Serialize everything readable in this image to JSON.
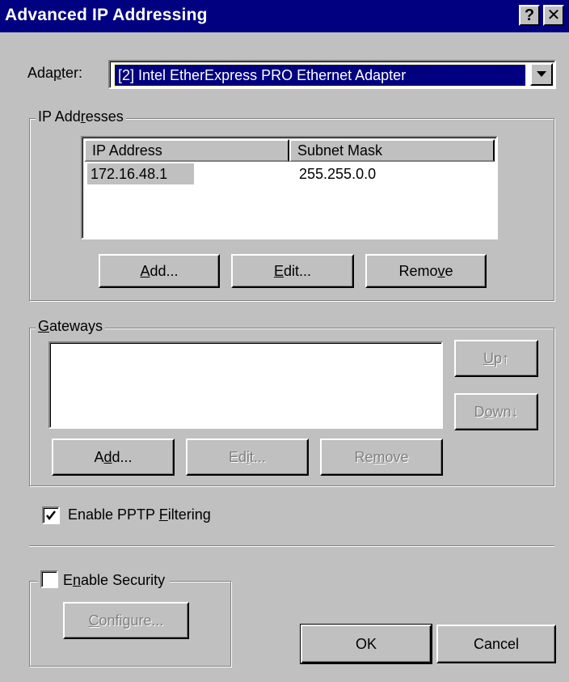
{
  "window": {
    "title": "Advanced IP Addressing",
    "help_icon_char": "?",
    "close_icon_char": "✕"
  },
  "adapter": {
    "label_pre": "Ada",
    "label_ul": "p",
    "label_post": "ter:",
    "selected": "[2] Intel EtherExpress PRO Ethernet Adapter"
  },
  "ip_addresses": {
    "group_pre": "IP Add",
    "group_ul": "r",
    "group_post": "esses",
    "columns": [
      "IP Address",
      "Subnet Mask"
    ],
    "rows": [
      {
        "ip": "172.16.48.1",
        "mask": "255.255.0.0"
      }
    ],
    "add": {
      "ul": "A",
      "rest": "dd..."
    },
    "edit": {
      "ul": "E",
      "rest": "dit..."
    },
    "remove": {
      "pre": "Remo",
      "ul": "v",
      "post": "e"
    }
  },
  "gateways": {
    "group_ul": "G",
    "group_rest": "ateways",
    "up": {
      "ul": "U",
      "rest": "p↑"
    },
    "down": {
      "pre": "D",
      "ul": "o",
      "post": "wn↓"
    },
    "add": {
      "pre": "A",
      "ul": "d",
      "post": "d..."
    },
    "edit": {
      "pre": "Ed",
      "ul": "i",
      "post": "t..."
    },
    "remove": {
      "pre": "Re",
      "ul": "m",
      "post": "ove"
    }
  },
  "pptp": {
    "checked": true,
    "pre": "Enable PPTP ",
    "ul": "F",
    "post": "iltering"
  },
  "security": {
    "checked": false,
    "pre": "E",
    "ul": "n",
    "post": "able Security",
    "configure": {
      "ul": "C",
      "rest": "onfigure..."
    }
  },
  "footer": {
    "ok": "OK",
    "cancel": "Cancel"
  },
  "colors": {
    "titlebar": "#000080",
    "face": "#c0c0c0",
    "selection": "#000080"
  }
}
